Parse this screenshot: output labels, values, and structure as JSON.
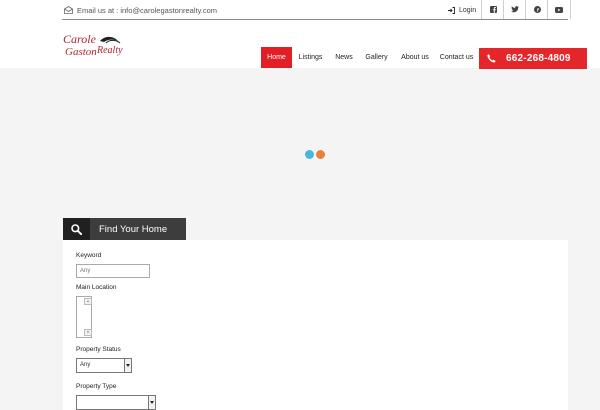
{
  "header": {
    "email_text": "Email us at : info@carolegastonrealty.com",
    "login_label": "Login",
    "social": [
      "facebook-icon",
      "twitter-icon",
      "pinterest-icon",
      "youtube-icon"
    ],
    "logo_line1": "Carole",
    "logo_line2": "Gaston",
    "logo_line3": "Realty"
  },
  "nav": {
    "items": [
      "Home",
      "Listings",
      "News",
      "Gallery",
      "About us",
      "Contact us"
    ],
    "active": "Home",
    "phone": "662-268-4809"
  },
  "search": {
    "tab_label": "Find Your Home",
    "keyword_label": "Keyword",
    "keyword_placeholder": "Any",
    "main_location_label": "Main Location",
    "property_status_label": "Property Status",
    "property_status_value": "Any",
    "property_type_label": "Property Type",
    "property_type_value": ""
  },
  "colors": {
    "accent_red": "#e21f25",
    "tab_dark": "#3d3d3d",
    "loader_blue": "#4bb6d9",
    "loader_orange": "#e8823a"
  }
}
